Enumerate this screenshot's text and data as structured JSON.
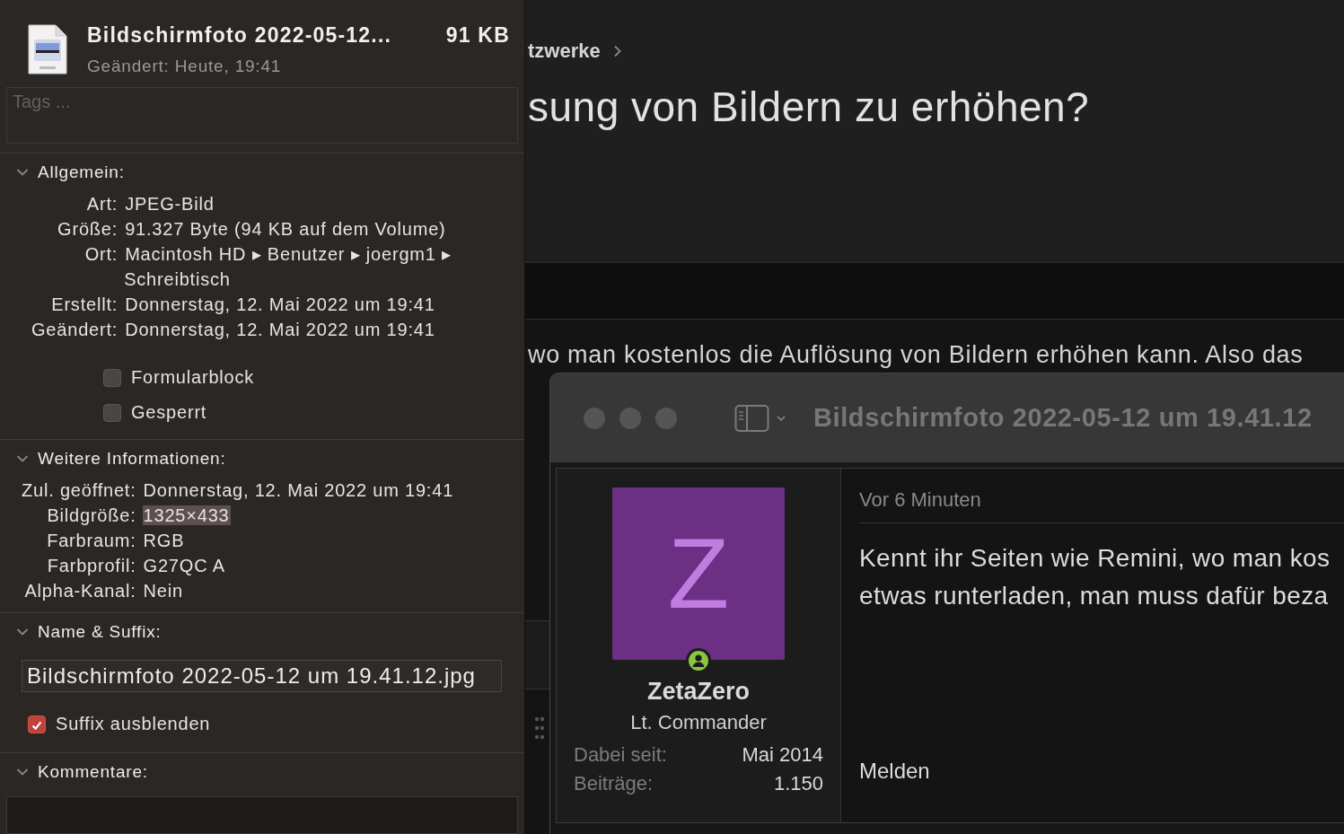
{
  "info_window": {
    "header": {
      "file_name": "Bildschirmfoto 2022-05-12...",
      "size": "91 KB",
      "modified": "Geändert: Heute, 19:41"
    },
    "tags": {
      "placeholder": "Tags ..."
    },
    "sections": [
      {
        "kind": "info",
        "title": "Allgemein:",
        "expanded": true,
        "rows": [
          {
            "label": "Art:",
            "value": "JPEG-Bild",
            "highlighted": false
          },
          {
            "label": "Größe:",
            "value": "91.327 Byte (94 KB auf dem Volume)",
            "highlighted": false
          },
          {
            "label": "Ort:",
            "value": "Macintosh HD ▸ Benutzer ▸ joergm1 ▸ Schreibtisch",
            "highlighted": false
          },
          {
            "label": "Erstellt:",
            "value": "Donnerstag, 12. Mai 2022 um 19:41",
            "highlighted": false
          },
          {
            "label": "Geändert:",
            "value": "Donnerstag, 12. Mai 2022 um 19:41",
            "highlighted": false
          }
        ],
        "checkboxes": [
          {
            "label": "Formularblock",
            "checked": false
          },
          {
            "label": "Gesperrt",
            "checked": false
          }
        ]
      },
      {
        "kind": "info",
        "title": "Weitere Informationen:",
        "expanded": true,
        "rows": [
          {
            "label": "Zul. geöffnet:",
            "value": "Donnerstag, 12. Mai 2022 um 19:41",
            "highlighted": false
          },
          {
            "label": "Bildgröße:",
            "value": "1325×433",
            "highlighted": true
          },
          {
            "label": "Farbraum:",
            "value": "RGB",
            "highlighted": false
          },
          {
            "label": "Farbprofil:",
            "value": "G27QC A",
            "highlighted": false
          },
          {
            "label": "Alpha-Kanal:",
            "value": "Nein",
            "highlighted": false
          }
        ]
      },
      {
        "kind": "name",
        "title": "Name & Suffix:",
        "expanded": true,
        "value": "Bildschirmfoto 2022-05-12 um 19.41.12.jpg",
        "checkboxes": [
          {
            "label": "Suffix ausblenden",
            "checked": true
          }
        ]
      },
      {
        "kind": "comments",
        "title": "Kommentare:",
        "expanded": true
      }
    ]
  },
  "web_page": {
    "breadcrumb": "tzwerke",
    "title": "sung von Bildern zu erhöhen?",
    "intro": "wo man kostenlos die Auflösung von Bildern erhöhen kann. Also das"
  },
  "preview_window": {
    "title": "Bildschirmfoto 2022-05-12 um 19.41.12",
    "post": {
      "avatar_letter": "Z",
      "online": true,
      "username": "ZetaZero",
      "rank": "Lt. Commander",
      "stats": [
        {
          "label": "Dabei seit:",
          "value": "Mai 2014"
        },
        {
          "label": "Beiträge:",
          "value": "1.150"
        }
      ],
      "time": "Vor 6 Minuten",
      "lines": [
        "Kennt ihr Seiten wie Remini, wo man kos",
        "etwas runterladen, man muss dafür beza"
      ],
      "report_link": "Melden"
    }
  }
}
